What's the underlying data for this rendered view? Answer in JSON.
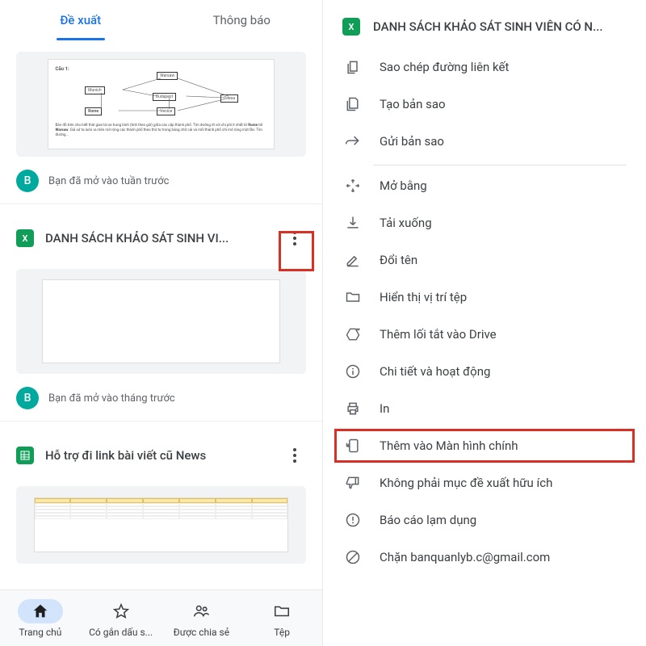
{
  "tabs": {
    "suggested": "Đề xuất",
    "notifications": "Thông báo"
  },
  "files": {
    "f1_meta": "Bạn đã mở vào tuần trước",
    "f2_title": "DANH SÁCH KHẢO SÁT SINH VI...",
    "f2_meta": "Bạn đã mở vào tháng trước",
    "f3_title": "Hỗ trợ đi link bài viết cũ News"
  },
  "avatar_letter": "B",
  "bottom": {
    "home": "Trang chủ",
    "starred": "Có gắn dấu s...",
    "shared": "Được chia sẻ",
    "files": "Tệp"
  },
  "context": {
    "title": "DANH SÁCH KHẢO SÁT SINH VIÊN CÓ N...",
    "copy_link": "Sao chép đường liên kết",
    "make_copy": "Tạo bản sao",
    "send_copy": "Gửi bản sao",
    "open_with": "Mở bằng",
    "download": "Tải xuống",
    "rename": "Đổi tên",
    "show_location": "Hiển thị vị trí tệp",
    "add_drive": "Thêm lối tắt vào Drive",
    "details": "Chi tiết và hoạt động",
    "print": "In",
    "add_home": "Thêm vào Màn hình chính",
    "not_helpful": "Không phải mục đề xuất hữu ích",
    "report": "Báo cáo lạm dụng",
    "block": "Chặn banquanlyb.c@gmail.com"
  }
}
